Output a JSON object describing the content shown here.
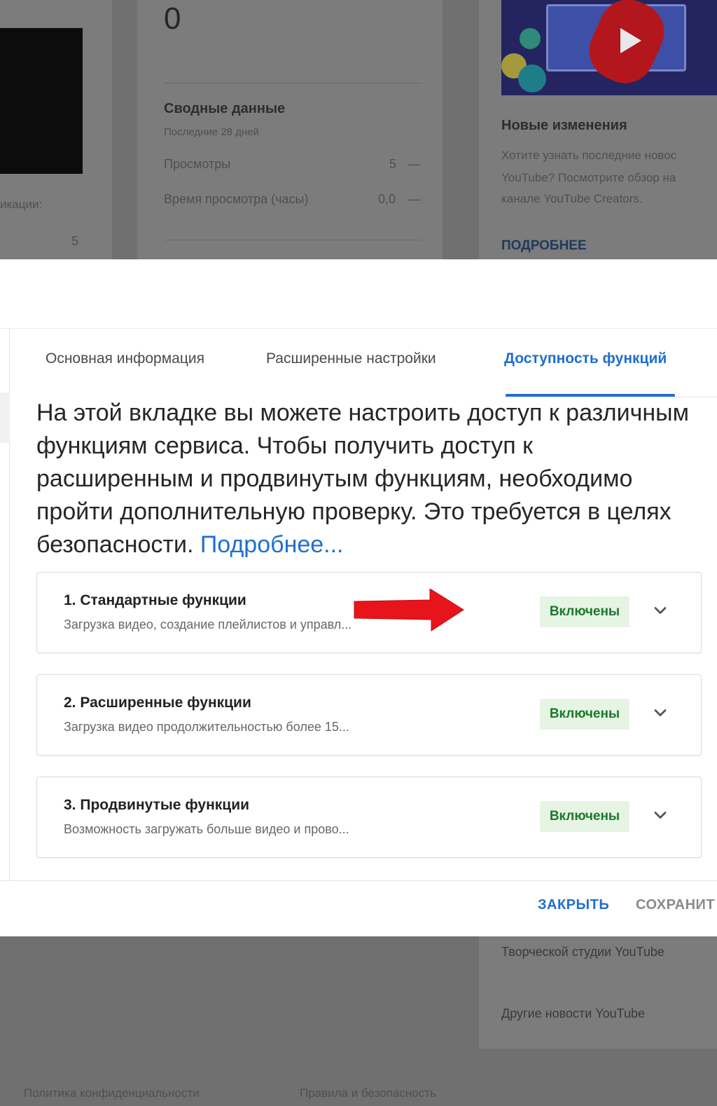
{
  "background": {
    "views_big": "0",
    "summary": {
      "title": "Сводные данные",
      "subtitle": "Последние 28 дней",
      "rows": [
        {
          "label": "Просмотры",
          "value": "5",
          "trend": "—"
        },
        {
          "label": "Время просмотра (часы)",
          "value": "0,0",
          "trend": "—"
        }
      ]
    },
    "left_label": "икации:",
    "left_value": "5",
    "news": {
      "title": "Новые изменения",
      "body_lines": [
        "Хотите узнать последние новос",
        "YouTube? Посмотрите обзор на",
        "канале YouTube Creators."
      ],
      "link": "ПОДРОБНЕЕ"
    },
    "news_bottom": {
      "line1": "Творческой студии YouTube",
      "line2": "Другие новости YouTube"
    },
    "footer_links": [
      "Политика конфиденциальности",
      "Правила и безопасность"
    ]
  },
  "modal": {
    "tabs": [
      {
        "label": "Основная информация",
        "active": false
      },
      {
        "label": "Расширенные настройки",
        "active": false
      },
      {
        "label": "Доступность функций",
        "active": true
      }
    ],
    "intro_text": "На этой вкладке вы можете настроить доступ к различным функциям сервиса. Чтобы получить доступ к расширенным и продвинутым функциям, необходимо пройти дополнительную проверку. Это требуется в целях безопасности. ",
    "intro_link": "Подробнее...",
    "features": [
      {
        "title": "1. Стандартные функции",
        "description": "Загрузка видео, создание плейлистов и управл...",
        "status": "Включены",
        "icon": "chevron-down-icon"
      },
      {
        "title": "2. Расширенные функции",
        "description": "Загрузка видео продолжительностью более 15...",
        "status": "Включены",
        "icon": "chevron-down-icon"
      },
      {
        "title": "3. Продвинутые функции",
        "description": "Возможность загружать больше видео и прово...",
        "status": "Включены",
        "icon": "chevron-down-icon"
      }
    ],
    "buttons": {
      "close": "ЗАКРЫТЬ",
      "save": "СОХРАНИТ"
    }
  },
  "colors": {
    "accent": "#1f6fce",
    "status_bg": "#e6f4e4",
    "status_text": "#1b7a2a",
    "annotation_arrow": "#e8141b"
  }
}
